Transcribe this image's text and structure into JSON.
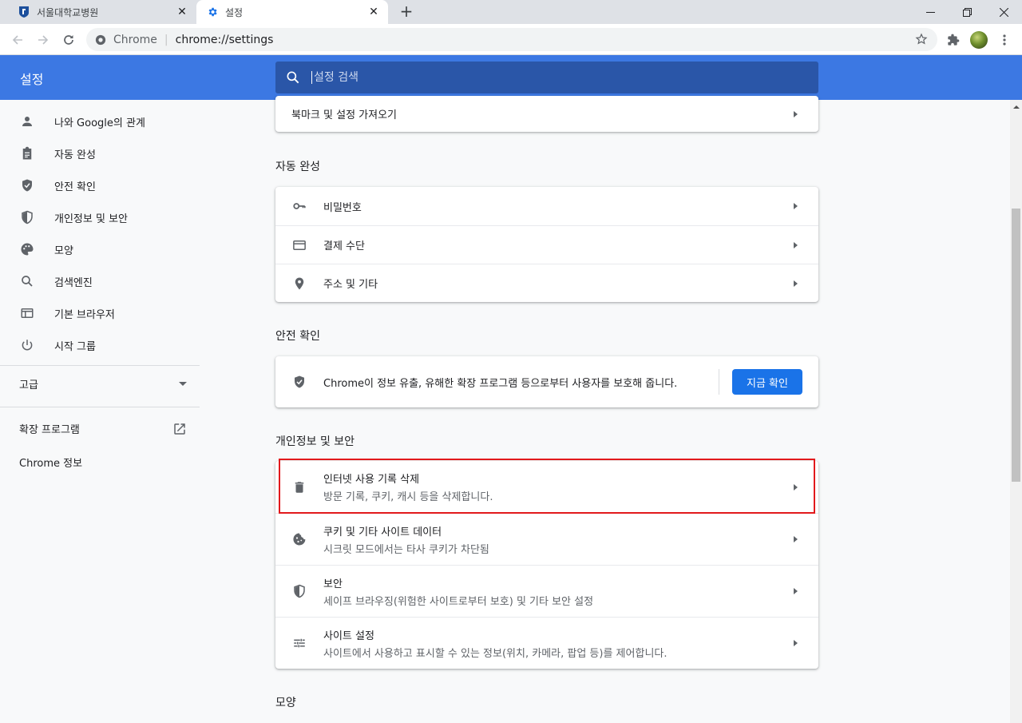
{
  "tabs": [
    {
      "title": "서울대학교병원",
      "active": false
    },
    {
      "title": "설정",
      "active": true
    }
  ],
  "omnibox": {
    "origin": "Chrome",
    "url": "chrome://settings"
  },
  "header": {
    "title": "설정",
    "search_placeholder": "설정 검색"
  },
  "sidebar": {
    "items": [
      {
        "label": "나와 Google의 관계",
        "icon": "person-icon"
      },
      {
        "label": "자동 완성",
        "icon": "clipboard-icon"
      },
      {
        "label": "안전 확인",
        "icon": "shield-check-icon"
      },
      {
        "label": "개인정보 및 보안",
        "icon": "shield-half-icon"
      },
      {
        "label": "모양",
        "icon": "palette-icon"
      },
      {
        "label": "검색엔진",
        "icon": "search-icon"
      },
      {
        "label": "기본 브라우저",
        "icon": "browser-icon"
      },
      {
        "label": "시작 그룹",
        "icon": "power-icon"
      }
    ],
    "advanced": "고급",
    "extensions": "확장 프로그램",
    "about": "Chrome 정보"
  },
  "main": {
    "import_row": "북마크 및 설정 가져오기",
    "autofill": {
      "title": "자동 완성",
      "rows": [
        {
          "label": "비밀번호",
          "icon": "key-icon"
        },
        {
          "label": "결제 수단",
          "icon": "credit-card-icon"
        },
        {
          "label": "주소 및 기타",
          "icon": "location-pin-icon"
        }
      ]
    },
    "safety": {
      "title": "안전 확인",
      "text": "Chrome이 정보 유출, 유해한 확장 프로그램 등으로부터 사용자를 보호해 줍니다.",
      "button": "지금 확인"
    },
    "privacy": {
      "title": "개인정보 및 보안",
      "rows": [
        {
          "label": "인터넷 사용 기록 삭제",
          "sub": "방문 기록, 쿠키, 캐시 등을 삭제합니다.",
          "icon": "trash-icon"
        },
        {
          "label": "쿠키 및 기타 사이트 데이터",
          "sub": "시크릿 모드에서는 타사 쿠키가 차단됨",
          "icon": "cookie-icon"
        },
        {
          "label": "보안",
          "sub": "세이프 브라우징(위험한 사이트로부터 보호) 및 기타 보안 설정",
          "icon": "shield-icon"
        },
        {
          "label": "사이트 설정",
          "sub": "사이트에서 사용하고 표시할 수 있는 정보(위치, 카메라, 팝업 등)를 제어합니다.",
          "icon": "tune-icon"
        }
      ]
    },
    "appearance": {
      "title": "모양"
    }
  },
  "colors": {
    "header": "#3c78e3",
    "accent": "#1a73e8",
    "highlight": "#e2191c"
  }
}
